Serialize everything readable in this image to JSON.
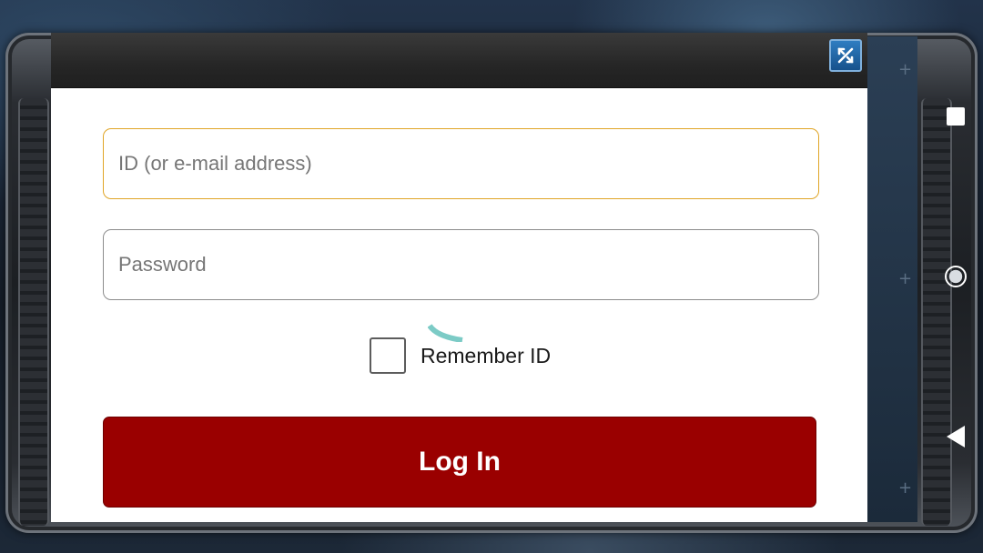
{
  "login_form": {
    "id_field": {
      "placeholder": "ID (or e-mail address)",
      "value": "",
      "focused": true
    },
    "password_field": {
      "placeholder": "Password",
      "value": ""
    },
    "remember_id": {
      "label": "Remember ID",
      "checked": false
    },
    "login_button": {
      "label": "Log In"
    }
  },
  "dialog": {
    "close_icon": "close-collapse-icon"
  },
  "nav_bar": {
    "recent_icon": "square-icon",
    "home_icon": "circle-icon",
    "back_icon": "back-triangle-icon"
  },
  "colors": {
    "login_button": "#9a0000",
    "focused_border": "#e0a526",
    "close_button": "#1f64a8",
    "spinner": "#7ccbc6",
    "header": "#262626"
  }
}
